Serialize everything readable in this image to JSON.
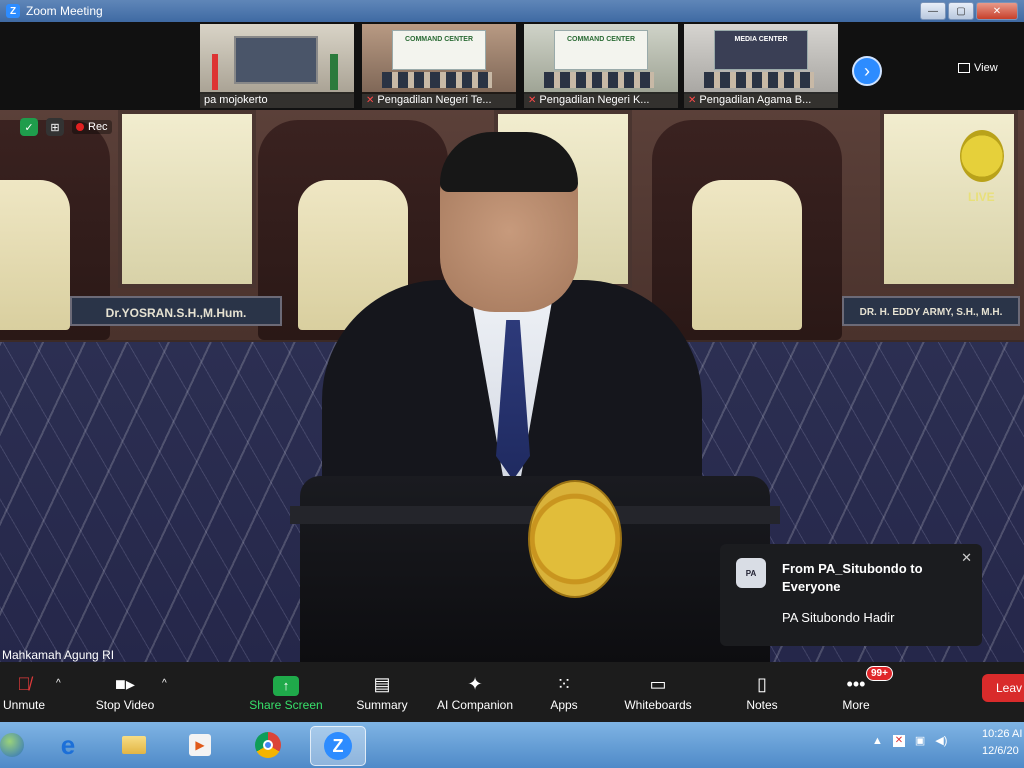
{
  "window": {
    "title": "Zoom Meeting",
    "controls": [
      "—",
      "▢",
      "✕"
    ]
  },
  "gallery": {
    "tiles": [
      {
        "name": "pa mojokerto",
        "muted": false
      },
      {
        "name": "Pengadilan Negeri Te...",
        "muted": true,
        "banner": "COMMAND CENTER"
      },
      {
        "name": "Pengadilan Negeri K...",
        "muted": true,
        "banner": "COMMAND CENTER"
      },
      {
        "name": "Pengadilan Agama B...",
        "muted": true,
        "banner": "MEDIA CENTER"
      }
    ],
    "next_icon": "chevron-right-icon",
    "view_label": "View"
  },
  "stage": {
    "speaker_name": "Mahkamah Agung RI",
    "recording_label": "Rec",
    "live_label": "LIVE",
    "nameplates": [
      "Dr.YOSRAN.S.H.,M.Hum.",
      "DR. H. EDDY ARMY, S.H., M.H."
    ]
  },
  "chat_notification": {
    "avatar_text": "PA",
    "from": "From PA_Situbondo to Everyone",
    "message": "PA Situbondo Hadir",
    "close": "✕"
  },
  "toolbar": {
    "unmute": "Unmute",
    "stop_video": "Stop Video",
    "share_screen": "Share Screen",
    "summary": "Summary",
    "ai_companion": "AI Companion",
    "apps": "Apps",
    "whiteboards": "Whiteboards",
    "notes": "Notes",
    "more": "More",
    "more_badge": "99+",
    "leave": "Leav",
    "share_color": "#1faa4a",
    "leave_color": "#d92b2b"
  },
  "taskbar": {
    "clock_time": "10:26 AI",
    "clock_date": "12/6/20"
  }
}
